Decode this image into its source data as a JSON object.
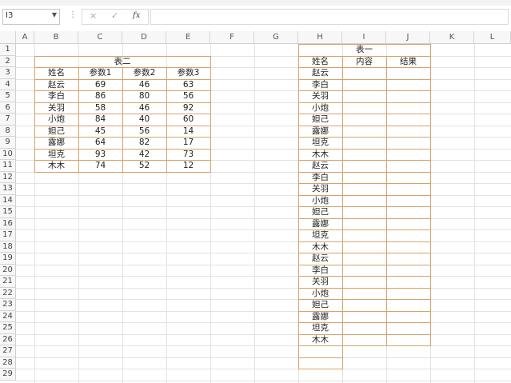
{
  "formula_bar": {
    "name_box": "I3",
    "separator": "⋮",
    "cancel_icon": "×",
    "enter_icon": "✓",
    "fx_label": "fx",
    "formula_value": ""
  },
  "columns": [
    "A",
    "B",
    "C",
    "D",
    "E",
    "F",
    "G",
    "H",
    "I",
    "J",
    "K",
    "L"
  ],
  "rows": [
    "1",
    "2",
    "3",
    "4",
    "5",
    "6",
    "7",
    "8",
    "9",
    "10",
    "11",
    "12",
    "13",
    "14",
    "15",
    "16",
    "17",
    "18",
    "19",
    "20",
    "21",
    "22",
    "23",
    "24",
    "25",
    "26",
    "27",
    "28",
    "29"
  ],
  "table2": {
    "title": "表二",
    "headers": [
      "姓名",
      "参数1",
      "参数2",
      "参数3"
    ],
    "rows": [
      [
        "赵云",
        "69",
        "46",
        "63"
      ],
      [
        "李白",
        "86",
        "80",
        "56"
      ],
      [
        "关羽",
        "58",
        "46",
        "92"
      ],
      [
        "小炮",
        "84",
        "40",
        "60"
      ],
      [
        "妲己",
        "45",
        "56",
        "14"
      ],
      [
        "露娜",
        "64",
        "82",
        "17"
      ],
      [
        "坦克",
        "93",
        "42",
        "73"
      ],
      [
        "木木",
        "74",
        "52",
        "12"
      ]
    ]
  },
  "table1": {
    "title": "表一",
    "headers": [
      "姓名",
      "内容",
      "结果"
    ],
    "names": [
      "赵云",
      "李白",
      "关羽",
      "小炮",
      "妲己",
      "露娜",
      "坦克",
      "木木",
      "赵云",
      "李白",
      "关羽",
      "小炮",
      "妲己",
      "露娜",
      "坦克",
      "木木",
      "赵云",
      "李白",
      "关羽",
      "小炮",
      "妲己",
      "露娜",
      "坦克",
      "木木"
    ]
  }
}
